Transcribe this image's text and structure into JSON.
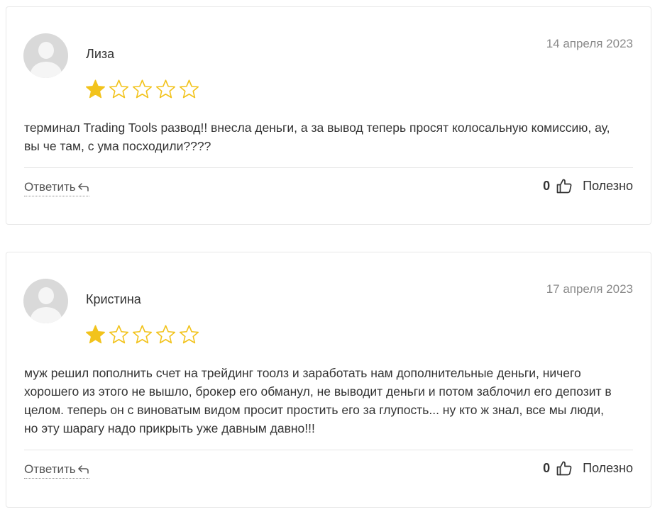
{
  "colors": {
    "star_filled": "#f2c31c",
    "star_outline": "#f2c31c"
  },
  "reviews": [
    {
      "author": "Лиза",
      "date": "14 апреля 2023",
      "rating": 1,
      "max_rating": 5,
      "text": "терминал Trading Tools развод!! внесла деньги, а за вывод теперь просят колосальную комиссию, ау, вы че там, с ума посходили????",
      "reply_label": "Ответить",
      "likes": "0",
      "useful_label": "Полезно"
    },
    {
      "author": "Кристина",
      "date": "17 апреля 2023",
      "rating": 1,
      "max_rating": 5,
      "text": "муж решил пополнить счет на трейдинг тоолз и заработать нам дополнительные деньги, ничего хорошего из этого не вышло, брокер его обманул, не выводит деньги и потом заблочил его депозит в целом. теперь он с виноватым видом просит простить его за глупость... ну кто ж знал, все мы люди, но эту шарагу надо прикрыть уже давным давно!!!",
      "reply_label": "Ответить",
      "likes": "0",
      "useful_label": "Полезно"
    }
  ]
}
